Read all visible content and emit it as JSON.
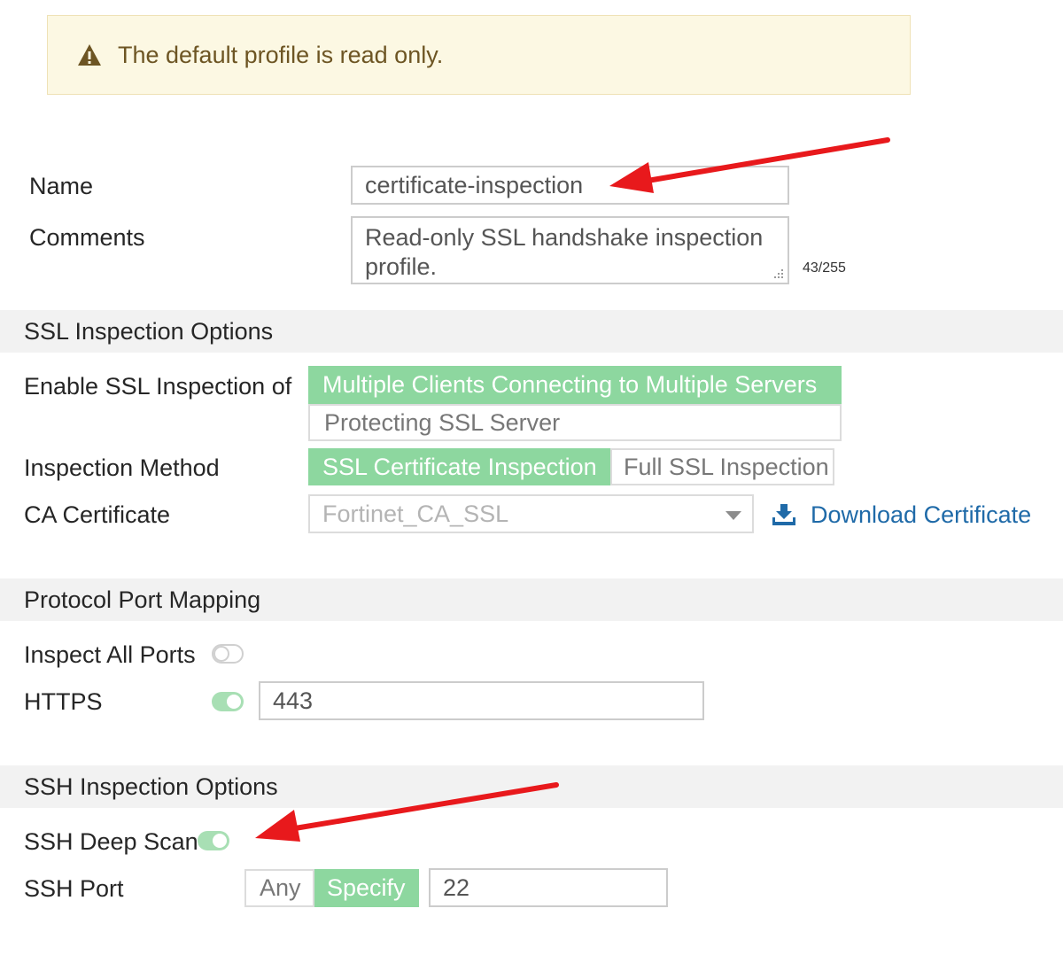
{
  "banner": {
    "icon": "warning-icon",
    "text": "The default profile is read only."
  },
  "form": {
    "name_label": "Name",
    "name_value": "certificate-inspection",
    "comments_label": "Comments",
    "comments_value": "Read-only SSL handshake inspection profile.",
    "comments_counter": "43/255"
  },
  "ssl_section": {
    "title": "SSL Inspection Options",
    "enable_label": "Enable SSL Inspection of",
    "enable_options": [
      "Multiple Clients Connecting to Multiple Servers",
      "Protecting SSL Server"
    ],
    "enable_selected": "Multiple Clients Connecting to Multiple Servers",
    "method_label": "Inspection Method",
    "method_options": [
      "SSL Certificate Inspection",
      "Full SSL Inspection"
    ],
    "method_selected": "SSL Certificate Inspection",
    "ca_label": "CA Certificate",
    "ca_value": "Fortinet_CA_SSL",
    "download_label": "Download Certificate",
    "download_icon": "download-icon"
  },
  "port_section": {
    "title": "Protocol Port Mapping",
    "inspect_all_label": "Inspect All Ports",
    "inspect_all_enabled": false,
    "https_label": "HTTPS",
    "https_enabled": true,
    "https_port": "443"
  },
  "ssh_section": {
    "title": "SSH Inspection Options",
    "deep_scan_label": "SSH Deep Scan",
    "deep_scan_enabled": true,
    "port_label": "SSH Port",
    "port_options": [
      "Any",
      "Specify"
    ],
    "port_selected": "Specify",
    "port_value": "22"
  },
  "colors": {
    "selected_green": "#8dd79f",
    "toggle_green": "#a8dfb4",
    "link_blue": "#1f6aa8",
    "annotation_red": "#e8191c",
    "banner_bg": "#fcf8e3"
  }
}
